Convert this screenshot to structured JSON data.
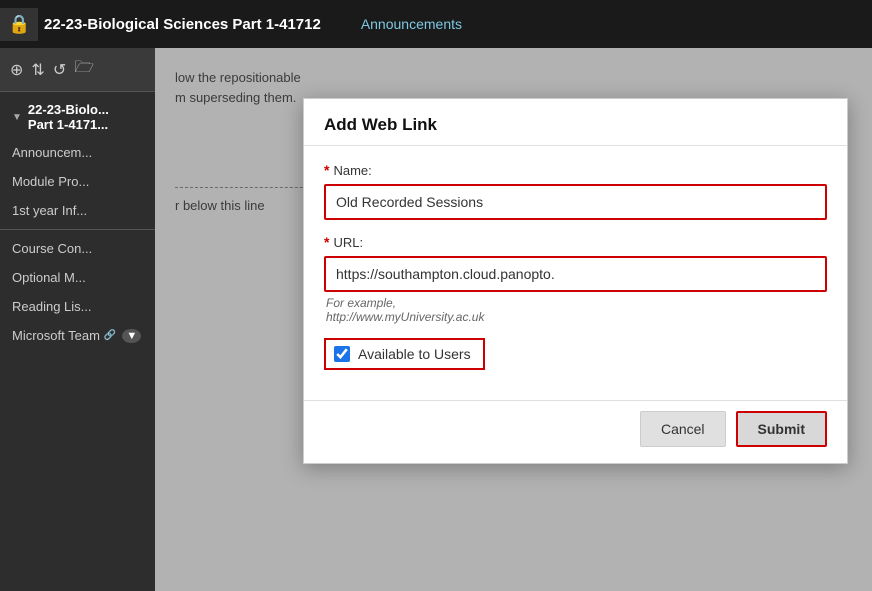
{
  "header": {
    "lock_icon": "🔒",
    "course_title": "22-23-Biological Sciences Part 1-41712",
    "nav_link": "Announcements"
  },
  "sidebar": {
    "toolbar_icons": [
      "⊕",
      "⇅",
      "↺",
      "🗁"
    ],
    "section_label": "22-23-Biolo... Part 1-4171...",
    "items": [
      {
        "label": "Announcem..."
      },
      {
        "label": "Module Pro..."
      },
      {
        "label": "1st year Inf..."
      },
      {
        "label": "Course Con..."
      },
      {
        "label": "Optional M..."
      },
      {
        "label": "Reading Lis..."
      },
      {
        "label": "Microsoft Team",
        "has_icon": true
      }
    ]
  },
  "content": {
    "line1": "low the repositionable",
    "line2": "m superseding them.",
    "dashed_label": "r below this line"
  },
  "modal": {
    "title": "Add Web Link",
    "name_label": "Name:",
    "name_value": "Old Recorded Sessions",
    "url_label": "URL:",
    "url_value": "https://southampton.cloud.panopto.",
    "hint_line1": "For example,",
    "hint_line2": "http://www.myUniversity.ac.uk",
    "checkbox_label": "Available to Users",
    "checkbox_checked": true,
    "cancel_label": "Cancel",
    "submit_label": "Submit"
  }
}
